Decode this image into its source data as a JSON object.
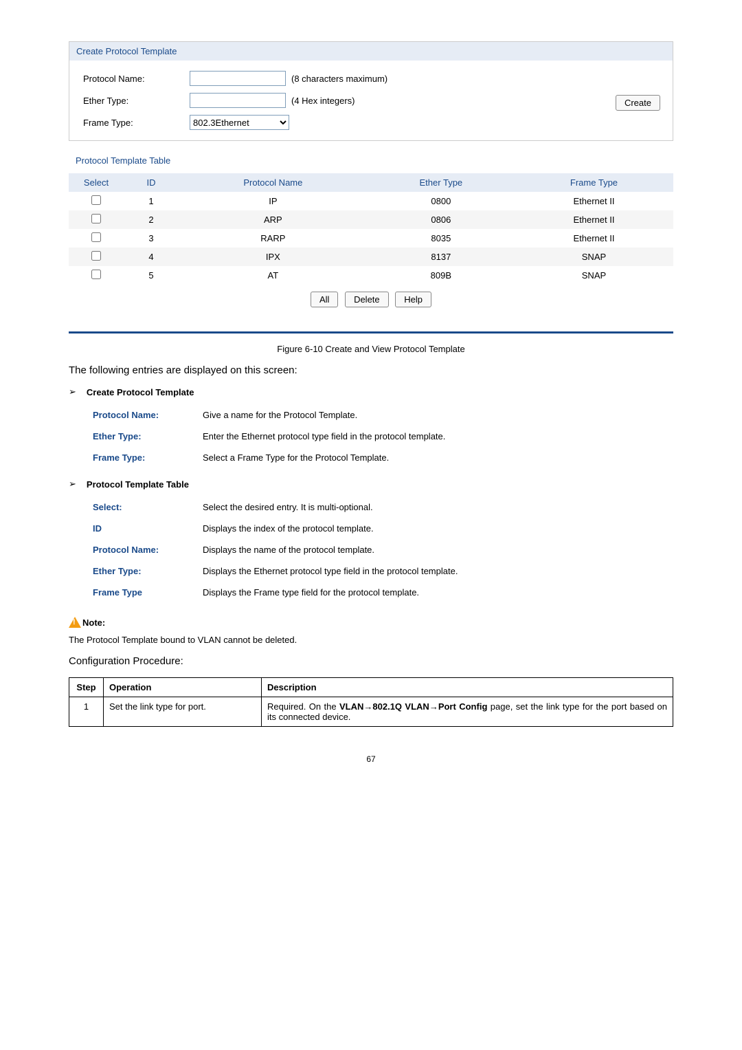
{
  "createSection": {
    "title": "Create Protocol Template",
    "protocolNameLabel": "Protocol Name:",
    "protocolNameHint": "(8 characters maximum)",
    "etherTypeLabel": "Ether Type:",
    "etherTypeHint": "(4 Hex integers)",
    "frameTypeLabel": "Frame Type:",
    "frameTypeSelected": "802.3Ethernet",
    "createBtn": "Create"
  },
  "tableSection": {
    "title": "Protocol Template Table",
    "headers": {
      "select": "Select",
      "id": "ID",
      "protocolName": "Protocol Name",
      "etherType": "Ether Type",
      "frameType": "Frame Type"
    },
    "rows": [
      {
        "id": "1",
        "name": "IP",
        "ether": "0800",
        "frame": "Ethernet II"
      },
      {
        "id": "2",
        "name": "ARP",
        "ether": "0806",
        "frame": "Ethernet II"
      },
      {
        "id": "3",
        "name": "RARP",
        "ether": "8035",
        "frame": "Ethernet II"
      },
      {
        "id": "4",
        "name": "IPX",
        "ether": "8137",
        "frame": "SNAP"
      },
      {
        "id": "5",
        "name": "AT",
        "ether": "809B",
        "frame": "SNAP"
      }
    ],
    "buttons": {
      "all": "All",
      "delete": "Delete",
      "help": "Help"
    }
  },
  "caption": "Figure 6-10 Create and View Protocol Template",
  "intro": "The following entries are displayed on this screen:",
  "defs": {
    "createTitle": "Create Protocol Template",
    "createItems": [
      {
        "term": "Protocol Name:",
        "desc": "Give a name for the Protocol Template."
      },
      {
        "term": "Ether Type:",
        "desc": "Enter the Ethernet protocol type field in the protocol template."
      },
      {
        "term": "Frame Type:",
        "desc": "Select a Frame Type for the Protocol Template."
      }
    ],
    "tableTitle": "Protocol Template Table",
    "tableItems": [
      {
        "term": "Select:",
        "desc": "Select the desired entry. It is multi-optional."
      },
      {
        "term": "ID",
        "desc": "Displays the index of the protocol template."
      },
      {
        "term": "Protocol Name:",
        "desc": "Displays the name of the protocol template."
      },
      {
        "term": "Ether Type:",
        "desc": "Displays the Ethernet protocol type field in the protocol template."
      },
      {
        "term": "Frame Type",
        "desc": "Displays the Frame type field for the protocol template."
      }
    ]
  },
  "note": {
    "label": "Note:",
    "text": "The Protocol Template bound to VLAN cannot be deleted."
  },
  "configHeading": "Configuration Procedure:",
  "procTable": {
    "headers": {
      "step": "Step",
      "operation": "Operation",
      "description": "Description"
    },
    "rows": [
      {
        "step": "1",
        "operation": "Set the link type for port.",
        "descPrefix": "Required. On the ",
        "descBold": "VLAN→802.1Q VLAN→Port Config",
        "descSuffix": " page, set the link type for the port based on its connected device."
      }
    ]
  },
  "pageNum": "67"
}
